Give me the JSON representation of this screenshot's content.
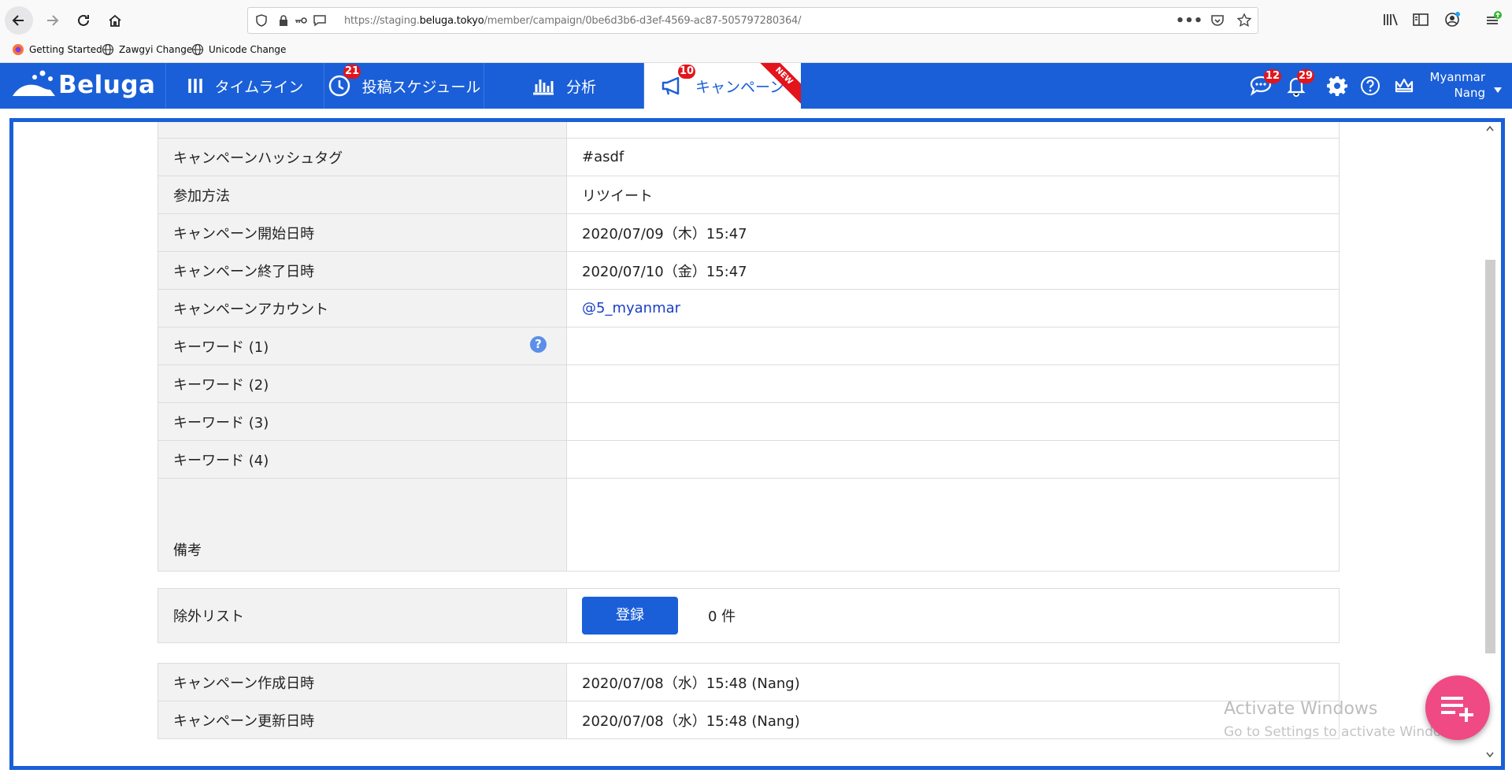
{
  "browser": {
    "url_prefix": "https://staging.",
    "url_domain": "beluga.tokyo",
    "url_path": "/member/campaign/0be6d3b6-d3ef-4569-ac87-505797280364/",
    "bookmarks": [
      "Getting Started",
      "Zawgyi Change",
      "Unicode Change"
    ]
  },
  "app": {
    "logo_text": "Beluga",
    "nav": [
      {
        "label": "タイムライン"
      },
      {
        "label": "投稿スケジュール",
        "badge": "21"
      },
      {
        "label": "分析"
      },
      {
        "label": "キャンペーン",
        "badge": "10",
        "ribbon": "NEW"
      }
    ],
    "messages_badge": "12",
    "notifications_badge": "29",
    "user_line1": "Myanmar",
    "user_line2": "Nang"
  },
  "details": {
    "rows": [
      {
        "label": "キャンペーンハッシュタグ",
        "value": "#asdf"
      },
      {
        "label": "参加方法",
        "value": "リツイート"
      },
      {
        "label": "キャンペーン開始日時",
        "value": "2020/07/09（木）15:47"
      },
      {
        "label": "キャンペーン終了日時",
        "value": "2020/07/10（金）15:47"
      },
      {
        "label": "キャンペーンアカウント",
        "value": "@5_myanmar"
      },
      {
        "label": "キーワード (1)",
        "value": ""
      },
      {
        "label": "キーワード (2)",
        "value": ""
      },
      {
        "label": "キーワード (3)",
        "value": ""
      },
      {
        "label": "キーワード (4)",
        "value": ""
      },
      {
        "label": "備考",
        "value": ""
      }
    ],
    "help_symbol": "?"
  },
  "exclusion": {
    "label": "除外リスト",
    "button": "登録",
    "count": "0 件"
  },
  "timestamps": {
    "rows": [
      {
        "label": "キャンペーン作成日時",
        "value": "2020/07/08（水）15:48 (Nang)"
      },
      {
        "label": "キャンペーン更新日時",
        "value": "2020/07/08（水）15:48 (Nang)"
      }
    ]
  },
  "watermark": {
    "line1": "Activate Windows",
    "line2": "Go to Settings to activate Windows."
  }
}
